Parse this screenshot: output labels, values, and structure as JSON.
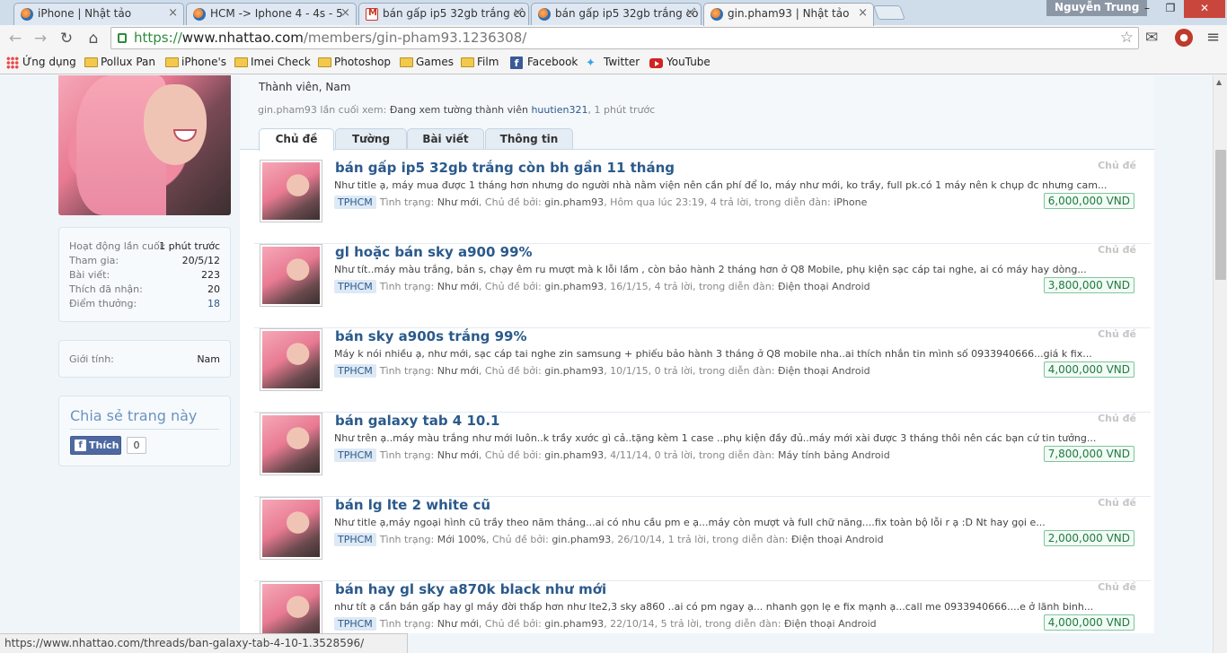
{
  "browser": {
    "tabs": [
      {
        "title": "iPhone | Nhật tảo",
        "active": false
      },
      {
        "title": "HCM -> Iphone 4 - 4s - 5",
        "active": false
      },
      {
        "title": "bán gấp ip5 32gb trắng cò",
        "active": false
      },
      {
        "title": "bán gấp ip5 32gb trắng cò",
        "active": false
      },
      {
        "title": "gin.pham93 | Nhật tảo",
        "active": true
      }
    ],
    "user": "Nguyễn Trung",
    "url_protocol": "https://",
    "url_host": "www.nhattao.com",
    "url_path": "/members/gin-pham93.1236308/",
    "bookmarks": [
      "Ứng dụng",
      "Pollux Pan",
      "iPhone's",
      "Imei Check",
      "Photoshop",
      "Games",
      "Film",
      "Facebook",
      "Twitter",
      "YouTube"
    ],
    "status_url": "https://www.nhattao.com/threads/ban-galaxy-tab-4-10-1.3528596/"
  },
  "profile": {
    "member_title": "Thành viên, Nam",
    "last_seen_prefix": "gin.pham93 lần cuối xem:",
    "last_seen_activity": "Đang xem tường thành viên",
    "last_seen_user": "huutien321",
    "last_seen_time": ", 1 phút trước"
  },
  "stats": [
    {
      "label": "Hoạt động lần cuối:",
      "value": "1 phút trước"
    },
    {
      "label": "Tham gia:",
      "value": "20/5/12"
    },
    {
      "label": "Bài viết:",
      "value": "223"
    },
    {
      "label": "Thích đã nhận:",
      "value": "20"
    },
    {
      "label": "Điểm thưởng:",
      "value": "18"
    }
  ],
  "gender": {
    "label": "Giới tính:",
    "value": "Nam"
  },
  "share": {
    "title": "Chia sẻ trang này",
    "like_label": "Thích",
    "like_count": "0"
  },
  "profile_tabs": [
    "Chủ đề",
    "Tường",
    "Bài viết",
    "Thông tin"
  ],
  "threads": [
    {
      "title": "bán gấp ip5 32gb trắng còn bh gần 11 tháng",
      "snippet": "Như title ạ, máy mua được 1 tháng hơn nhưng do người nhà nằm viện nên cần phí để lo, máy như mới, ko trầy, full pk.có 1 máy nên k chụp đc nhưng cam...",
      "prefix": "TPHCM",
      "condition_label": "Tình trạng:",
      "condition": "Như mới",
      "starter_label": ", Chủ đề bởi:",
      "starter": "gin.pham93",
      "date": ", Hôm qua lúc 23:19",
      "replies": ", 4 trả lời",
      "forum_label": ", trong diễn đàn:",
      "forum": "iPhone",
      "type_label": "Chủ đề",
      "price": "6,000,000 VND"
    },
    {
      "title": "gl hoặc bán sky a900 99%",
      "snippet": "Như tít..máy màu trắng, bản s, chạy êm ru mượt mà k lỗi lầm , còn bảo hành 2 tháng hơn ở Q8 Mobile, phụ kiện sạc cáp tai nghe, ai có máy hay dòng...",
      "prefix": "TPHCM",
      "condition_label": "Tình trạng:",
      "condition": "Như mới",
      "starter_label": ", Chủ đề bởi:",
      "starter": "gin.pham93",
      "date": ", 16/1/15",
      "replies": ", 4 trả lời",
      "forum_label": ", trong diễn đàn:",
      "forum": "Điện thoại Android",
      "type_label": "Chủ đề",
      "price": "3,800,000 VND"
    },
    {
      "title": "bán sky a900s trắng 99%",
      "snippet": "Máy k nói nhiều ạ, như mới, sạc cáp tai nghe zin samsung + phiếu bảo hành 3 tháng ở Q8 mobile nha..ai thích nhắn tin mình số 0933940666...giá k fix...",
      "prefix": "TPHCM",
      "condition_label": "Tình trạng:",
      "condition": "Như mới",
      "starter_label": ", Chủ đề bởi:",
      "starter": "gin.pham93",
      "date": ", 10/1/15",
      "replies": ", 0 trả lời",
      "forum_label": ", trong diễn đàn:",
      "forum": "Điện thoại Android",
      "type_label": "Chủ đề",
      "price": "4,000,000 VND"
    },
    {
      "title": "bán galaxy tab 4 10.1",
      "snippet": "Như trên ạ..máy màu trắng như mới luôn..k trầy xước gì cả..tặng kèm 1 case ..phụ kiện đầy đủ..máy mới xài được 3 tháng thôi nên các bạn cứ tin tưởng...",
      "prefix": "TPHCM",
      "condition_label": "Tình trạng:",
      "condition": "Như mới",
      "starter_label": ", Chủ đề bởi:",
      "starter": "gin.pham93",
      "date": ", 4/11/14",
      "replies": ", 0 trả lời",
      "forum_label": ", trong diễn đàn:",
      "forum": "Máy tính bảng Android",
      "type_label": "Chủ đề",
      "price": "7,800,000 VND"
    },
    {
      "title": "bán lg lte 2 white cũ",
      "snippet": "Như title ạ,máy ngoại hình cũ trầy theo năm tháng...ai có nhu cầu pm e ạ...máy còn mượt và full chữ năng....fix toàn bộ lỗi r ạ :D Nt hay gọi e...",
      "prefix": "TPHCM",
      "condition_label": "Tình trạng:",
      "condition": "Mới 100%",
      "starter_label": ", Chủ đề bởi:",
      "starter": "gin.pham93",
      "date": ", 26/10/14",
      "replies": ", 1 trả lời",
      "forum_label": ", trong diễn đàn:",
      "forum": "Điện thoại Android",
      "type_label": "Chủ đề",
      "price": "2,000,000 VND"
    },
    {
      "title": "bán hay gl sky a870k black như mới",
      "snippet": "như tít ạ cần bán gấp hay gl máy đời thấp hơn như lte2,3 sky a860 ..ai có pm ngay ạ... nhanh gọn lẹ e fix mạnh ạ...call me 0933940666....e ở lãnh binh...",
      "prefix": "TPHCM",
      "condition_label": "Tình trạng:",
      "condition": "Như mới",
      "starter_label": ", Chủ đề bởi:",
      "starter": "gin.pham93",
      "date": ", 22/10/14",
      "replies": ", 5 trả lời",
      "forum_label": ", trong diễn đàn:",
      "forum": "Điện thoại Android",
      "type_label": "Chủ đề",
      "price": "4,000,000 VND"
    }
  ]
}
